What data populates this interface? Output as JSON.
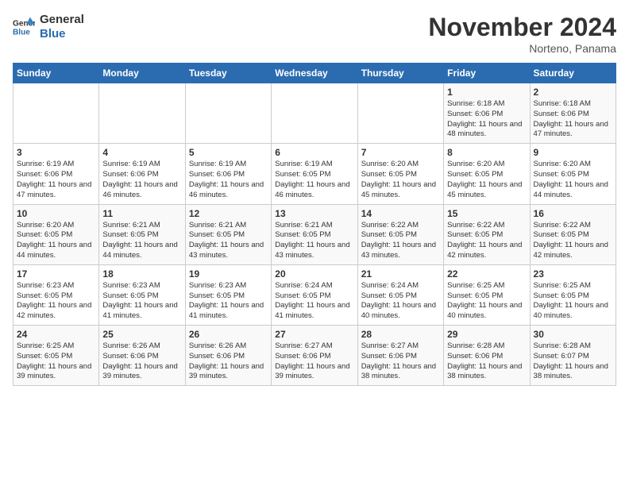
{
  "header": {
    "logo_line1": "General",
    "logo_line2": "Blue",
    "month_title": "November 2024",
    "subtitle": "Norteno, Panama"
  },
  "weekdays": [
    "Sunday",
    "Monday",
    "Tuesday",
    "Wednesday",
    "Thursday",
    "Friday",
    "Saturday"
  ],
  "weeks": [
    [
      {
        "day": "",
        "info": ""
      },
      {
        "day": "",
        "info": ""
      },
      {
        "day": "",
        "info": ""
      },
      {
        "day": "",
        "info": ""
      },
      {
        "day": "",
        "info": ""
      },
      {
        "day": "1",
        "info": "Sunrise: 6:18 AM\nSunset: 6:06 PM\nDaylight: 11 hours and 48 minutes."
      },
      {
        "day": "2",
        "info": "Sunrise: 6:18 AM\nSunset: 6:06 PM\nDaylight: 11 hours and 47 minutes."
      }
    ],
    [
      {
        "day": "3",
        "info": "Sunrise: 6:19 AM\nSunset: 6:06 PM\nDaylight: 11 hours and 47 minutes."
      },
      {
        "day": "4",
        "info": "Sunrise: 6:19 AM\nSunset: 6:06 PM\nDaylight: 11 hours and 46 minutes."
      },
      {
        "day": "5",
        "info": "Sunrise: 6:19 AM\nSunset: 6:06 PM\nDaylight: 11 hours and 46 minutes."
      },
      {
        "day": "6",
        "info": "Sunrise: 6:19 AM\nSunset: 6:05 PM\nDaylight: 11 hours and 46 minutes."
      },
      {
        "day": "7",
        "info": "Sunrise: 6:20 AM\nSunset: 6:05 PM\nDaylight: 11 hours and 45 minutes."
      },
      {
        "day": "8",
        "info": "Sunrise: 6:20 AM\nSunset: 6:05 PM\nDaylight: 11 hours and 45 minutes."
      },
      {
        "day": "9",
        "info": "Sunrise: 6:20 AM\nSunset: 6:05 PM\nDaylight: 11 hours and 44 minutes."
      }
    ],
    [
      {
        "day": "10",
        "info": "Sunrise: 6:20 AM\nSunset: 6:05 PM\nDaylight: 11 hours and 44 minutes."
      },
      {
        "day": "11",
        "info": "Sunrise: 6:21 AM\nSunset: 6:05 PM\nDaylight: 11 hours and 44 minutes."
      },
      {
        "day": "12",
        "info": "Sunrise: 6:21 AM\nSunset: 6:05 PM\nDaylight: 11 hours and 43 minutes."
      },
      {
        "day": "13",
        "info": "Sunrise: 6:21 AM\nSunset: 6:05 PM\nDaylight: 11 hours and 43 minutes."
      },
      {
        "day": "14",
        "info": "Sunrise: 6:22 AM\nSunset: 6:05 PM\nDaylight: 11 hours and 43 minutes."
      },
      {
        "day": "15",
        "info": "Sunrise: 6:22 AM\nSunset: 6:05 PM\nDaylight: 11 hours and 42 minutes."
      },
      {
        "day": "16",
        "info": "Sunrise: 6:22 AM\nSunset: 6:05 PM\nDaylight: 11 hours and 42 minutes."
      }
    ],
    [
      {
        "day": "17",
        "info": "Sunrise: 6:23 AM\nSunset: 6:05 PM\nDaylight: 11 hours and 42 minutes."
      },
      {
        "day": "18",
        "info": "Sunrise: 6:23 AM\nSunset: 6:05 PM\nDaylight: 11 hours and 41 minutes."
      },
      {
        "day": "19",
        "info": "Sunrise: 6:23 AM\nSunset: 6:05 PM\nDaylight: 11 hours and 41 minutes."
      },
      {
        "day": "20",
        "info": "Sunrise: 6:24 AM\nSunset: 6:05 PM\nDaylight: 11 hours and 41 minutes."
      },
      {
        "day": "21",
        "info": "Sunrise: 6:24 AM\nSunset: 6:05 PM\nDaylight: 11 hours and 40 minutes."
      },
      {
        "day": "22",
        "info": "Sunrise: 6:25 AM\nSunset: 6:05 PM\nDaylight: 11 hours and 40 minutes."
      },
      {
        "day": "23",
        "info": "Sunrise: 6:25 AM\nSunset: 6:05 PM\nDaylight: 11 hours and 40 minutes."
      }
    ],
    [
      {
        "day": "24",
        "info": "Sunrise: 6:25 AM\nSunset: 6:05 PM\nDaylight: 11 hours and 39 minutes."
      },
      {
        "day": "25",
        "info": "Sunrise: 6:26 AM\nSunset: 6:06 PM\nDaylight: 11 hours and 39 minutes."
      },
      {
        "day": "26",
        "info": "Sunrise: 6:26 AM\nSunset: 6:06 PM\nDaylight: 11 hours and 39 minutes."
      },
      {
        "day": "27",
        "info": "Sunrise: 6:27 AM\nSunset: 6:06 PM\nDaylight: 11 hours and 39 minutes."
      },
      {
        "day": "28",
        "info": "Sunrise: 6:27 AM\nSunset: 6:06 PM\nDaylight: 11 hours and 38 minutes."
      },
      {
        "day": "29",
        "info": "Sunrise: 6:28 AM\nSunset: 6:06 PM\nDaylight: 11 hours and 38 minutes."
      },
      {
        "day": "30",
        "info": "Sunrise: 6:28 AM\nSunset: 6:07 PM\nDaylight: 11 hours and 38 minutes."
      }
    ]
  ]
}
